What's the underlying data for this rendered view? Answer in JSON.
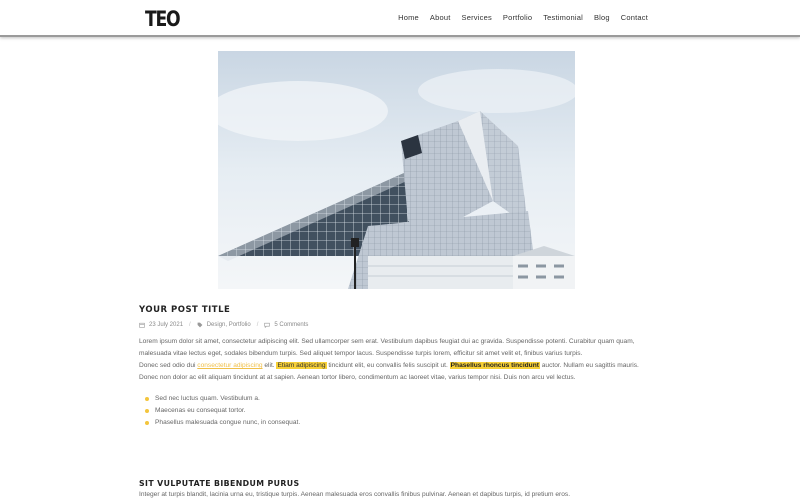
{
  "header": {
    "logo": "TEO",
    "nav": [
      "Home",
      "About",
      "Services",
      "Portfolio",
      "Testimonial",
      "Blog",
      "Contact"
    ]
  },
  "post": {
    "title": "YOUR POST TITLE",
    "date": "23 July 2021",
    "categories": "Design, Portfolio",
    "comments": "5 Comments",
    "paragraph1": "Lorem ipsum dolor sit amet, consectetur adipiscing elit. Sed ullamcorper sem erat. Vestibulum dapibus feugiat dui ac gravida. Suspendisse potenti. Curabitur quam quam, malesuada vitae lectus eget, sodales bibendum turpis. Sed aliquet tempor lacus. Suspendisse turpis lorem, efficitur sit amet velit et, finibus varius turpis.",
    "p2_a": "Donec sed odio dui ",
    "p2_link": "consectetur adipiscing",
    "p2_b": " elit. ",
    "p2_mark": "Etiam adipiscing",
    "p2_c": " tincidunt elit, eu convallis felis suscipit ut. ",
    "p2_strong": "Phasellus rhoncus tincidunt",
    "p2_d": " auctor. Nullam eu sagittis mauris. Donec non dolor ac elit aliquam tincidunt at at sapien. Aenean tortor libero, condimentum ac laoreet vitae, varius tempor nisi. Duis non arcu vel lectus.",
    "bullets": [
      "Sed nec luctus quam. Vestibulum a.",
      "Maecenas eu consequat tortor.",
      "Phasellus malesuada congue nunc, in consequat."
    ]
  },
  "section2": {
    "title": "SIT VULPUTATE BIBENDUM PURUS",
    "text": "Integer at turpis blandit, lacinia urna eu, tristique turpis. Aenean malesuada eros convallis finibus pulvinar. Aenean et dapibus turpis, id pretium eros."
  },
  "colors": {
    "accent": "#f7d036",
    "link": "#f0c04a"
  }
}
